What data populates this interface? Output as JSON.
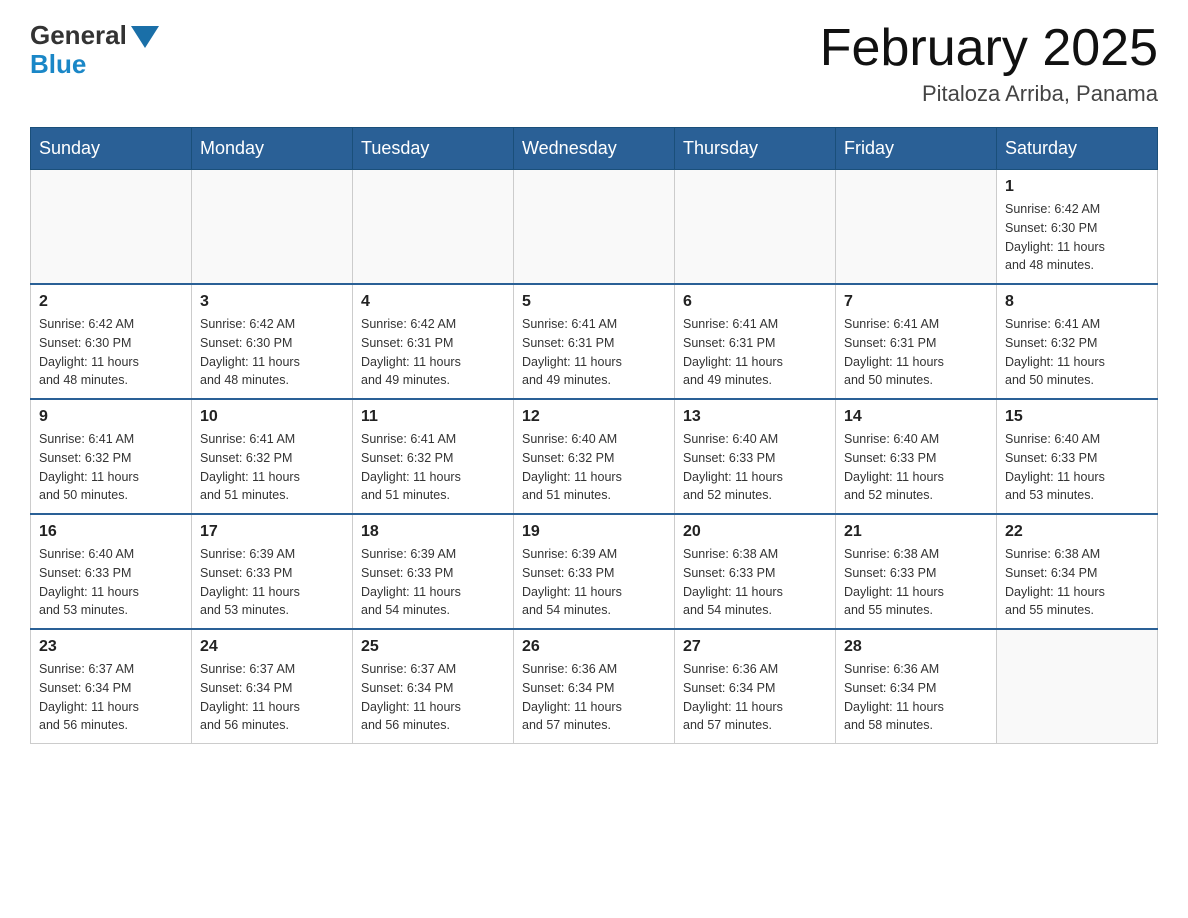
{
  "header": {
    "logo_general": "General",
    "logo_blue": "Blue",
    "month_title": "February 2025",
    "location": "Pitaloza Arriba, Panama"
  },
  "days_of_week": [
    "Sunday",
    "Monday",
    "Tuesday",
    "Wednesday",
    "Thursday",
    "Friday",
    "Saturday"
  ],
  "weeks": [
    [
      {
        "num": "",
        "info": ""
      },
      {
        "num": "",
        "info": ""
      },
      {
        "num": "",
        "info": ""
      },
      {
        "num": "",
        "info": ""
      },
      {
        "num": "",
        "info": ""
      },
      {
        "num": "",
        "info": ""
      },
      {
        "num": "1",
        "info": "Sunrise: 6:42 AM\nSunset: 6:30 PM\nDaylight: 11 hours\nand 48 minutes."
      }
    ],
    [
      {
        "num": "2",
        "info": "Sunrise: 6:42 AM\nSunset: 6:30 PM\nDaylight: 11 hours\nand 48 minutes."
      },
      {
        "num": "3",
        "info": "Sunrise: 6:42 AM\nSunset: 6:30 PM\nDaylight: 11 hours\nand 48 minutes."
      },
      {
        "num": "4",
        "info": "Sunrise: 6:42 AM\nSunset: 6:31 PM\nDaylight: 11 hours\nand 49 minutes."
      },
      {
        "num": "5",
        "info": "Sunrise: 6:41 AM\nSunset: 6:31 PM\nDaylight: 11 hours\nand 49 minutes."
      },
      {
        "num": "6",
        "info": "Sunrise: 6:41 AM\nSunset: 6:31 PM\nDaylight: 11 hours\nand 49 minutes."
      },
      {
        "num": "7",
        "info": "Sunrise: 6:41 AM\nSunset: 6:31 PM\nDaylight: 11 hours\nand 50 minutes."
      },
      {
        "num": "8",
        "info": "Sunrise: 6:41 AM\nSunset: 6:32 PM\nDaylight: 11 hours\nand 50 minutes."
      }
    ],
    [
      {
        "num": "9",
        "info": "Sunrise: 6:41 AM\nSunset: 6:32 PM\nDaylight: 11 hours\nand 50 minutes."
      },
      {
        "num": "10",
        "info": "Sunrise: 6:41 AM\nSunset: 6:32 PM\nDaylight: 11 hours\nand 51 minutes."
      },
      {
        "num": "11",
        "info": "Sunrise: 6:41 AM\nSunset: 6:32 PM\nDaylight: 11 hours\nand 51 minutes."
      },
      {
        "num": "12",
        "info": "Sunrise: 6:40 AM\nSunset: 6:32 PM\nDaylight: 11 hours\nand 51 minutes."
      },
      {
        "num": "13",
        "info": "Sunrise: 6:40 AM\nSunset: 6:33 PM\nDaylight: 11 hours\nand 52 minutes."
      },
      {
        "num": "14",
        "info": "Sunrise: 6:40 AM\nSunset: 6:33 PM\nDaylight: 11 hours\nand 52 minutes."
      },
      {
        "num": "15",
        "info": "Sunrise: 6:40 AM\nSunset: 6:33 PM\nDaylight: 11 hours\nand 53 minutes."
      }
    ],
    [
      {
        "num": "16",
        "info": "Sunrise: 6:40 AM\nSunset: 6:33 PM\nDaylight: 11 hours\nand 53 minutes."
      },
      {
        "num": "17",
        "info": "Sunrise: 6:39 AM\nSunset: 6:33 PM\nDaylight: 11 hours\nand 53 minutes."
      },
      {
        "num": "18",
        "info": "Sunrise: 6:39 AM\nSunset: 6:33 PM\nDaylight: 11 hours\nand 54 minutes."
      },
      {
        "num": "19",
        "info": "Sunrise: 6:39 AM\nSunset: 6:33 PM\nDaylight: 11 hours\nand 54 minutes."
      },
      {
        "num": "20",
        "info": "Sunrise: 6:38 AM\nSunset: 6:33 PM\nDaylight: 11 hours\nand 54 minutes."
      },
      {
        "num": "21",
        "info": "Sunrise: 6:38 AM\nSunset: 6:33 PM\nDaylight: 11 hours\nand 55 minutes."
      },
      {
        "num": "22",
        "info": "Sunrise: 6:38 AM\nSunset: 6:34 PM\nDaylight: 11 hours\nand 55 minutes."
      }
    ],
    [
      {
        "num": "23",
        "info": "Sunrise: 6:37 AM\nSunset: 6:34 PM\nDaylight: 11 hours\nand 56 minutes."
      },
      {
        "num": "24",
        "info": "Sunrise: 6:37 AM\nSunset: 6:34 PM\nDaylight: 11 hours\nand 56 minutes."
      },
      {
        "num": "25",
        "info": "Sunrise: 6:37 AM\nSunset: 6:34 PM\nDaylight: 11 hours\nand 56 minutes."
      },
      {
        "num": "26",
        "info": "Sunrise: 6:36 AM\nSunset: 6:34 PM\nDaylight: 11 hours\nand 57 minutes."
      },
      {
        "num": "27",
        "info": "Sunrise: 6:36 AM\nSunset: 6:34 PM\nDaylight: 11 hours\nand 57 minutes."
      },
      {
        "num": "28",
        "info": "Sunrise: 6:36 AM\nSunset: 6:34 PM\nDaylight: 11 hours\nand 58 minutes."
      },
      {
        "num": "",
        "info": ""
      }
    ]
  ]
}
